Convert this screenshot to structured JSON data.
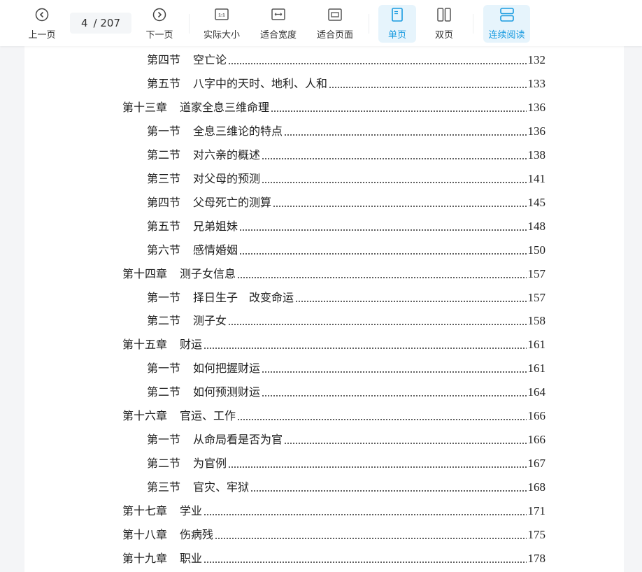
{
  "toolbar": {
    "prev": {
      "label": "上一页",
      "icon": "chevron-left-circle"
    },
    "page_current": "4",
    "page_total": "/ 207",
    "next": {
      "label": "下一页",
      "icon": "chevron-right-circle"
    },
    "actual_size": {
      "label": "实际大小",
      "icon": "one-to-one",
      "glyph": "1:1"
    },
    "fit_width": {
      "label": "适合宽度",
      "icon": "fit-width"
    },
    "fit_page": {
      "label": "适合页面",
      "icon": "fit-page"
    },
    "single_page": {
      "label": "单页",
      "icon": "single-page",
      "active": true
    },
    "double_page": {
      "label": "双页",
      "icon": "double-page"
    },
    "continuous": {
      "label": "连续阅读",
      "icon": "continuous-scroll",
      "active": true
    },
    "accent_color": "#1a9be0",
    "active_bg": "#e6f4fc"
  },
  "toc": [
    {
      "level": "section",
      "label": "第四节",
      "title": "空亡论",
      "page": "132"
    },
    {
      "level": "section",
      "label": "第五节",
      "title": "八字中的天时、地利、人和",
      "page": "133"
    },
    {
      "level": "chapter",
      "label": "第十三章",
      "title": "道家全息三维命理",
      "page": "136"
    },
    {
      "level": "section",
      "label": "第一节",
      "title": "全息三维论的特点",
      "page": "136"
    },
    {
      "level": "section",
      "label": "第二节",
      "title": "对六亲的概述",
      "page": "138"
    },
    {
      "level": "section",
      "label": "第三节",
      "title": "对父母的预测",
      "page": "141"
    },
    {
      "level": "section",
      "label": "第四节",
      "title": "父母死亡的测算",
      "page": "145"
    },
    {
      "level": "section",
      "label": "第五节",
      "title": "兄弟姐妹",
      "page": "148"
    },
    {
      "level": "section",
      "label": "第六节",
      "title": "感情婚姻",
      "page": "150"
    },
    {
      "level": "chapter",
      "label": "第十四章",
      "title": "测子女信息",
      "page": "157"
    },
    {
      "level": "section",
      "label": "第一节",
      "title": "择日生子　改变命运",
      "page": "157"
    },
    {
      "level": "section",
      "label": "第二节",
      "title": "测子女",
      "page": "158"
    },
    {
      "level": "chapter",
      "label": "第十五章",
      "title": "财运",
      "page": "161"
    },
    {
      "level": "section",
      "label": "第一节",
      "title": "如何把握财运",
      "page": "161"
    },
    {
      "level": "section",
      "label": "第二节",
      "title": "如何预测财运",
      "page": "164"
    },
    {
      "level": "chapter",
      "label": "第十六章",
      "title": "官运、工作",
      "page": "166"
    },
    {
      "level": "section",
      "label": "第一节",
      "title": "从命局看是否为官",
      "page": "166"
    },
    {
      "level": "section",
      "label": "第二节",
      "title": "为官例",
      "page": "167"
    },
    {
      "level": "section",
      "label": "第三节",
      "title": "官灾、牢狱",
      "page": "168"
    },
    {
      "level": "chapter",
      "label": "第十七章",
      "title": "学业",
      "page": "171"
    },
    {
      "level": "chapter",
      "label": "第十八章",
      "title": "伤病残",
      "page": "175"
    },
    {
      "level": "chapter",
      "label": "第十九章",
      "title": "职业",
      "page": "178"
    }
  ]
}
